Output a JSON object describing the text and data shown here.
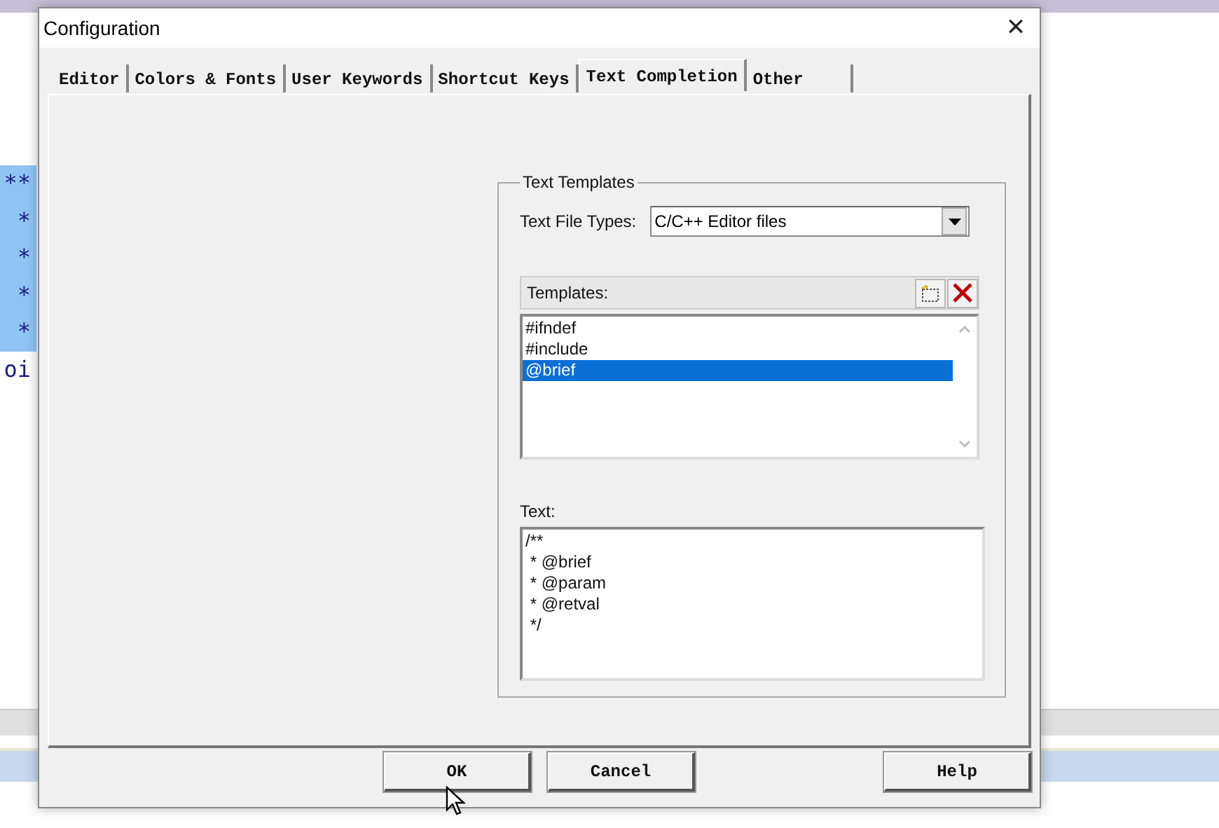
{
  "editor": {
    "code_lines": [
      {
        "text": "**",
        "selected": true
      },
      {
        "text": "*",
        "selected": true
      },
      {
        "text": "*",
        "selected": true
      },
      {
        "text": "*",
        "selected": true
      },
      {
        "text": "*",
        "selected": true
      },
      {
        "text": "oi",
        "selected": false
      }
    ]
  },
  "window": {
    "title": "Configuration",
    "close": "✕"
  },
  "tabs": [
    {
      "label": "Editor",
      "selected": false
    },
    {
      "label": "Colors & Fonts",
      "selected": false
    },
    {
      "label": "User Keywords",
      "selected": false
    },
    {
      "label": "Shortcut Keys",
      "selected": false
    },
    {
      "label": "Text Completion",
      "selected": true
    },
    {
      "label": "Other",
      "selected": false
    }
  ],
  "group": {
    "title": "Text Templates",
    "file_types_label": "Text File Types:",
    "file_types_value": "C/C++ Editor files",
    "templates_label": "Templates:",
    "templates": [
      {
        "name": "#ifndef",
        "selected": false
      },
      {
        "name": "#include",
        "selected": false
      },
      {
        "name": "@brief",
        "selected": true
      }
    ],
    "text_label": "Text:",
    "text_value": "/**\n * @brief \n * @param\n * @retval\n */"
  },
  "buttons": [
    "OK",
    "Cancel",
    "Help"
  ]
}
